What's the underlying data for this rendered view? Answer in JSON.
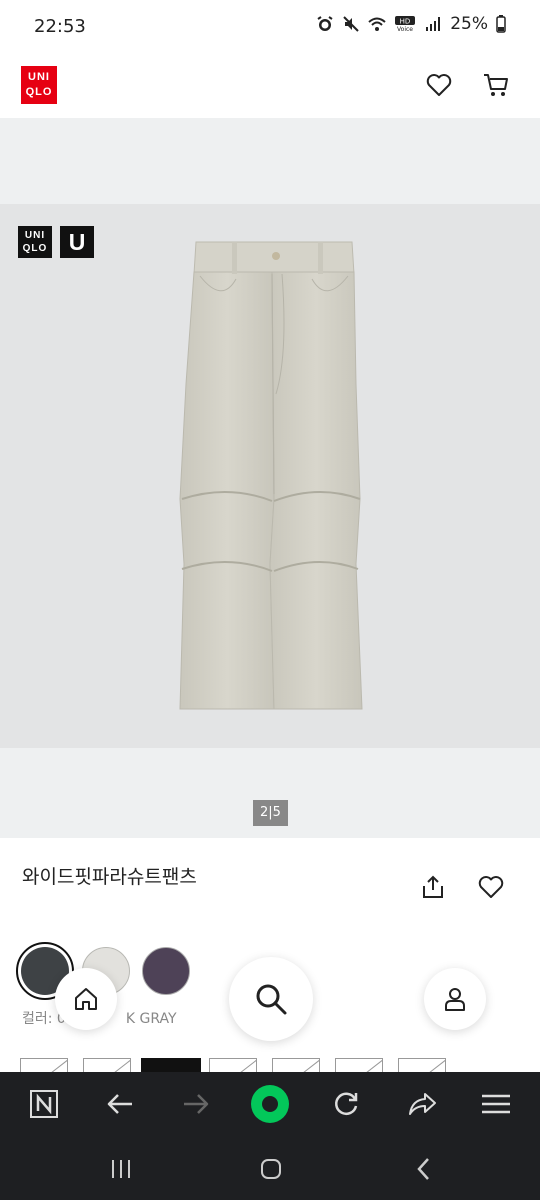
{
  "status": {
    "time": "22:53",
    "battery": "25%",
    "icons": [
      "alarm-icon",
      "mute-icon",
      "wifi-icon",
      "volte-icon",
      "signal-icon",
      "battery-icon"
    ]
  },
  "header": {
    "logo_line1": "UNI",
    "logo_line2": "QLO",
    "logo_color": "#e60012",
    "icons": [
      "heart-icon",
      "cart-icon"
    ]
  },
  "gallery": {
    "badge_line1": "UNI",
    "badge_line2": "QLO",
    "badge_u": "U",
    "page": "2|5"
  },
  "product": {
    "title": "와이드핏파라슈트팬츠",
    "color_label": "컬러: 0",
    "color_label_suffix": "K GRAY",
    "swatches": [
      {
        "name": "dark-gray",
        "color": "#3e4245",
        "selected": true
      },
      {
        "name": "light-gray",
        "color": "#e2e1dd",
        "selected": false
      },
      {
        "name": "purple",
        "color": "#4e4257",
        "selected": false
      }
    ]
  },
  "floating": {
    "icons": [
      "home-icon",
      "search-icon",
      "user-icon"
    ]
  },
  "browser_bar": {
    "icons": [
      "naver-n-icon",
      "back-icon",
      "forward-icon",
      "green-dot-icon",
      "refresh-icon",
      "share-icon",
      "menu-icon"
    ],
    "accent": "#03c75a"
  },
  "system_nav": {
    "icons": [
      "recents-icon",
      "home-button-icon",
      "back-button-icon"
    ]
  }
}
